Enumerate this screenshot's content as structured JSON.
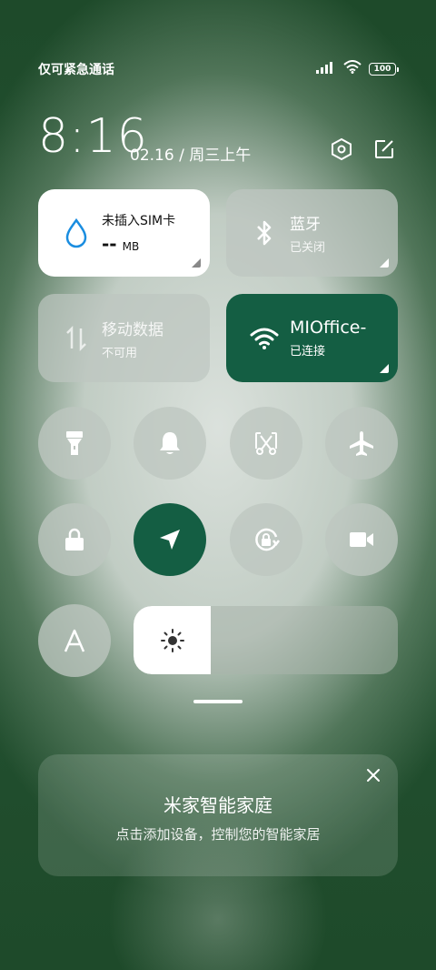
{
  "status_bar": {
    "carrier": "仅可紧急通话",
    "battery": "100"
  },
  "header": {
    "time": "8:16",
    "date": "02.16 / 周三上午"
  },
  "tiles": {
    "data_usage": {
      "title": "未插入SIM卡",
      "value": "--",
      "unit": "MB"
    },
    "bluetooth": {
      "title": "蓝牙",
      "status": "已关闭"
    },
    "mobile_data": {
      "title": "移动数据",
      "status": "不可用"
    },
    "wifi": {
      "title": "MIOffice-",
      "status": "已连接"
    }
  },
  "colors": {
    "accent": "#145e43",
    "background": "#1e4a2a"
  },
  "toggles_row1": [
    "flashlight-icon",
    "bell-icon",
    "screenshot-icon",
    "airplane-icon"
  ],
  "toggles_row2": [
    "lock-icon",
    "location-icon",
    "rotation-lock-icon",
    "video-icon"
  ],
  "card": {
    "title": "米家智能家庭",
    "subtitle": "点击添加设备，控制您的智能家居"
  }
}
